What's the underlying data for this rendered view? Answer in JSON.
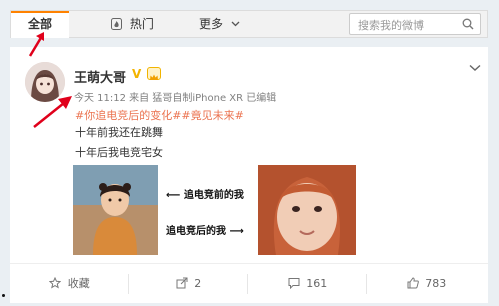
{
  "nav": {
    "tab_all": "全部",
    "tab_hot": "热门",
    "tab_more": "更多",
    "search_placeholder": "搜索我的微博"
  },
  "post": {
    "username": "王萌大哥",
    "meta": "今天 11:12 来自 猛哥自制iPhone XR  已编辑",
    "hashtags": "#你追电竞后的变化##竟见未来#",
    "line1": "十年前我还在跳舞",
    "line2": "十年后我电竞宅女",
    "caption_before": "追电竞前的我",
    "caption_after": "追电竞后的我"
  },
  "actions": {
    "favorite": "收藏",
    "share": "2",
    "comment": "161",
    "like": "783"
  },
  "colors": {
    "accent_orange": "#ff8200",
    "hashtag": "#eb7350",
    "arrow_red": "#e0001b"
  }
}
